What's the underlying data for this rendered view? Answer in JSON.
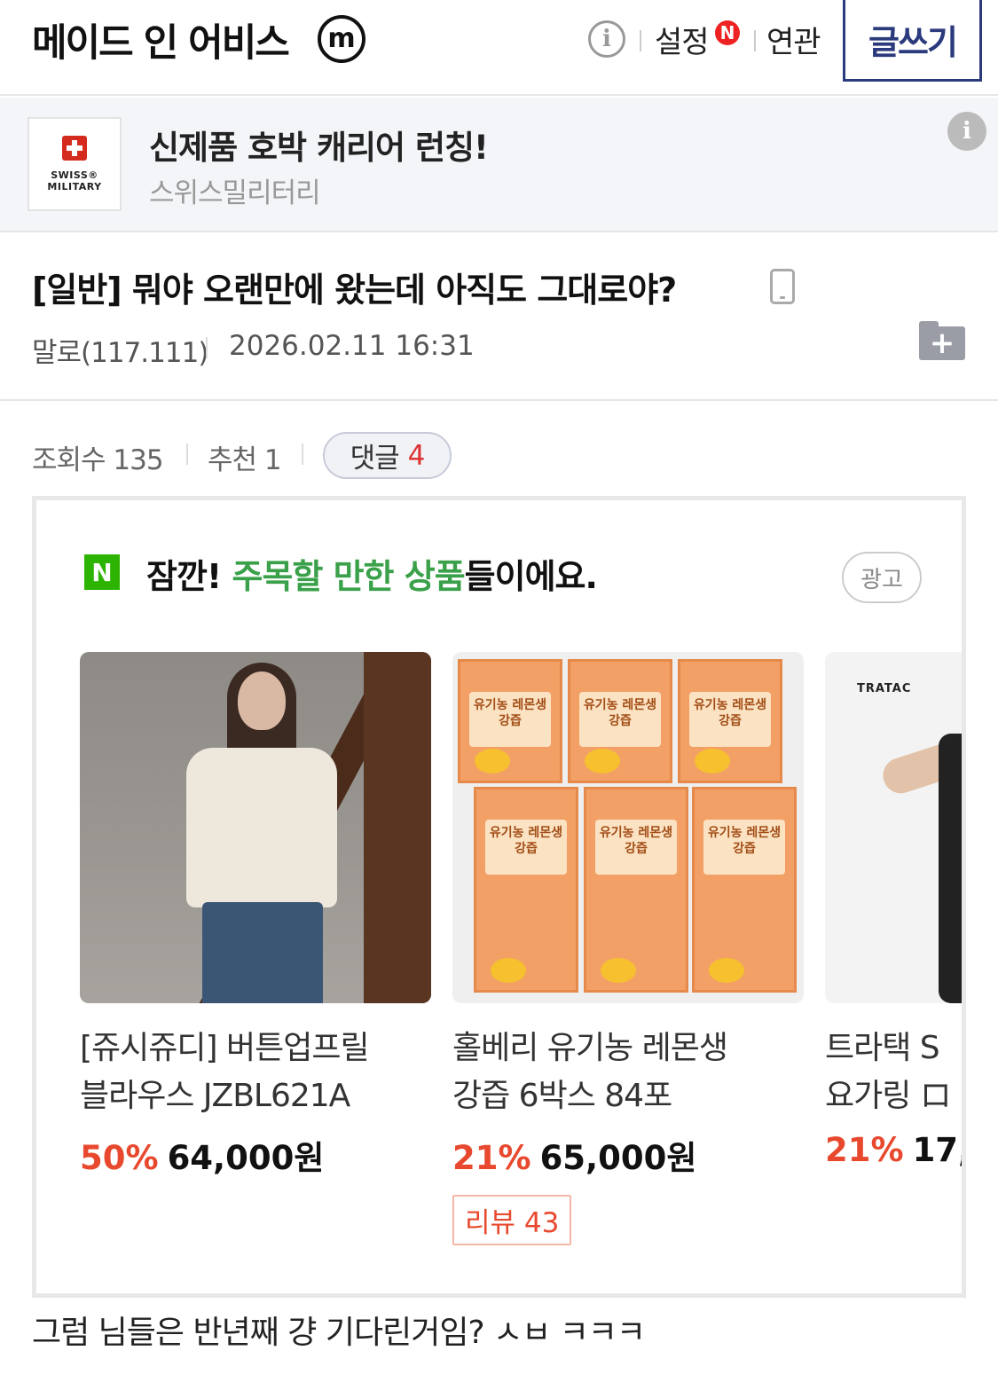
{
  "header": {
    "gallery_title": "메이드 인 어비스",
    "minor_badge": "m",
    "info_icon": "i",
    "settings_label": "설정",
    "new_badge": "N",
    "related_label": "연관",
    "write_label": "글쓰기"
  },
  "ad_banner": {
    "logo_line1": "SWISS®",
    "logo_line2": "MILITARY",
    "title": "신제품 호박 캐리어 런칭!",
    "advertiser": "스위스밀리터리",
    "info_icon": "i"
  },
  "post": {
    "title": "[일반] 뭐야 오랜만에 왔는데 아직도 그대로야?",
    "author": "말로(117.111)",
    "date": "2026.02.11 16:31",
    "folder_plus": "+",
    "views_label": "조회수 135",
    "recommend_label": "추천 1",
    "comments_label": "댓글",
    "comments_count": "4",
    "body": "그럼 님들은 반년째 걍 기다린거임? ㅅㅂ ㅋㅋㅋ"
  },
  "promo": {
    "n_logo": "N",
    "title_prefix": "잠깐! ",
    "title_highlight": "주목할 만한 상품",
    "title_suffix": "들이에요.",
    "ad_badge": "광고",
    "products": [
      {
        "name_line1": "[쥬시쥬디] 버튼업프릴",
        "name_line2": "블라우스 JZBL621A",
        "discount": "50%",
        "price": "64,000원",
        "review": ""
      },
      {
        "name_line1": "홀베리 유기농 레몬생",
        "name_line2": "강즙 6박스 84포",
        "discount": "21%",
        "price": "65,000원",
        "review": "리뷰 43",
        "box_label": "유기농 레몬생강즙"
      },
      {
        "name_line1": "트라택 S",
        "name_line2": "요가링 ロ",
        "discount": "21%",
        "price": "17,",
        "review": "",
        "brand_logo": "TRATAC"
      }
    ]
  },
  "colors": {
    "accent_navy": "#2b3a7c",
    "naver_green": "#2db400",
    "highlight_green": "#3aa14a",
    "discount_red": "#e8492e",
    "comment_count_red": "#d33"
  }
}
